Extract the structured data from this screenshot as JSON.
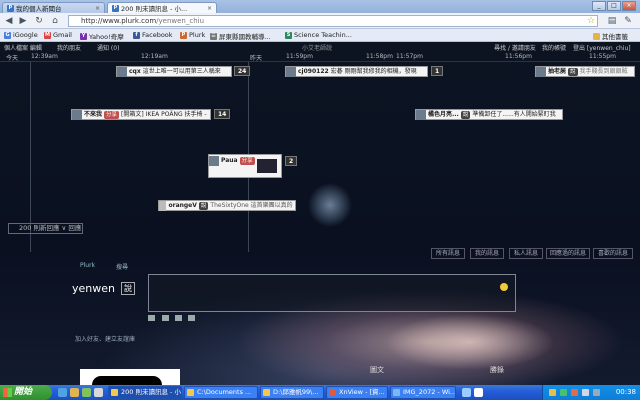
{
  "browser": {
    "tabs": [
      {
        "label": "我的個人新聞台",
        "favicon": "P",
        "active": false
      },
      {
        "label": "200 則未讀訊息 - 小...",
        "favicon": "P",
        "active": true
      }
    ],
    "window_controls": {
      "minimize": "_",
      "maximize": "□",
      "close": "×"
    },
    "url": {
      "host": "http://www.plurk.com",
      "path": "/yenwen_chiu"
    },
    "bookmarks": [
      {
        "label": "iGoogle",
        "icon": "G"
      },
      {
        "label": "Gmail",
        "icon": "M"
      },
      {
        "label": "Yahoo!奇摩",
        "icon": "Y"
      },
      {
        "label": "Facebook",
        "icon": "f"
      },
      {
        "label": "Plurk",
        "icon": "P"
      },
      {
        "label": "屏東縣國教輔導...",
        "icon": "☰"
      },
      {
        "label": "Science Teachin...",
        "icon": "S"
      }
    ],
    "other_bookmarks": "其他書籤"
  },
  "plurk": {
    "topnav": {
      "profile": "個人檔案 編輯",
      "friends": "我的朋友",
      "notify": "通知 (0)",
      "site_title": "小艾老師說",
      "search_friends": "尋找 / 邀請朋友",
      "account": "我的帳號",
      "logout": "登出 [yenwen_chiu]"
    },
    "timeline": {
      "today": "今天",
      "t1": "12:39am",
      "t2": "12:19am",
      "yesterday": "昨天",
      "t3": "11:59pm",
      "t4": "11:58pm",
      "t5": "11:57pm",
      "t6": "11:56pm",
      "t7": "11:55pm"
    },
    "plurks": [
      {
        "who": "cqx",
        "qualifier": "",
        "text": "這世上唯一可以用第三人稱來",
        "count": "24"
      },
      {
        "who": "cj090122",
        "qualifier": "",
        "text": "宏碁 剛剛幫我修我的相機，發現",
        "count": "1"
      },
      {
        "who": "抽老屍",
        "qualifier": "說",
        "text": "我手賤長到銀銀賊",
        "count": ""
      },
      {
        "who": "不來我",
        "qualifier": "分享",
        "text": "[開箱文] IKEA POÄNG 扶手椅 -",
        "count": "14"
      },
      {
        "who": "橘色月亮...",
        "qualifier": "說",
        "text": "準備卸任了......有人開始緊盯我",
        "count": ""
      },
      {
        "who": "Paua",
        "qualifier": "分享",
        "text": "",
        "count": "2"
      },
      {
        "who": "orangeV",
        "qualifier": "說",
        "text": "TheSixtyOne 這首樂團以真的是",
        "count": ""
      }
    ],
    "unread_button": "200 則新回應 ∨ 回應",
    "filters": [
      "所有訊息",
      "我的訊息",
      "私人訊息",
      "回應過的訊息",
      "喜歡的訊息"
    ],
    "misc": {
      "plurk_link": "Plurk",
      "search_link": "搜尋"
    },
    "composer": {
      "username": "yenwen",
      "qualifier": "說"
    },
    "bottom_labels": {
      "left": "加入好友、建立友誼庫",
      "center": "圖文",
      "right": "勝錄"
    }
  },
  "taskbar": {
    "start": "開始",
    "tasks": [
      "200 則未讀訊息 - 小...",
      "C:\\Documents ...",
      "D:\\邱雅帆99\\...",
      "XnView - [資...",
      "IMG_2072 - Wi..."
    ],
    "clock": "00:38"
  }
}
